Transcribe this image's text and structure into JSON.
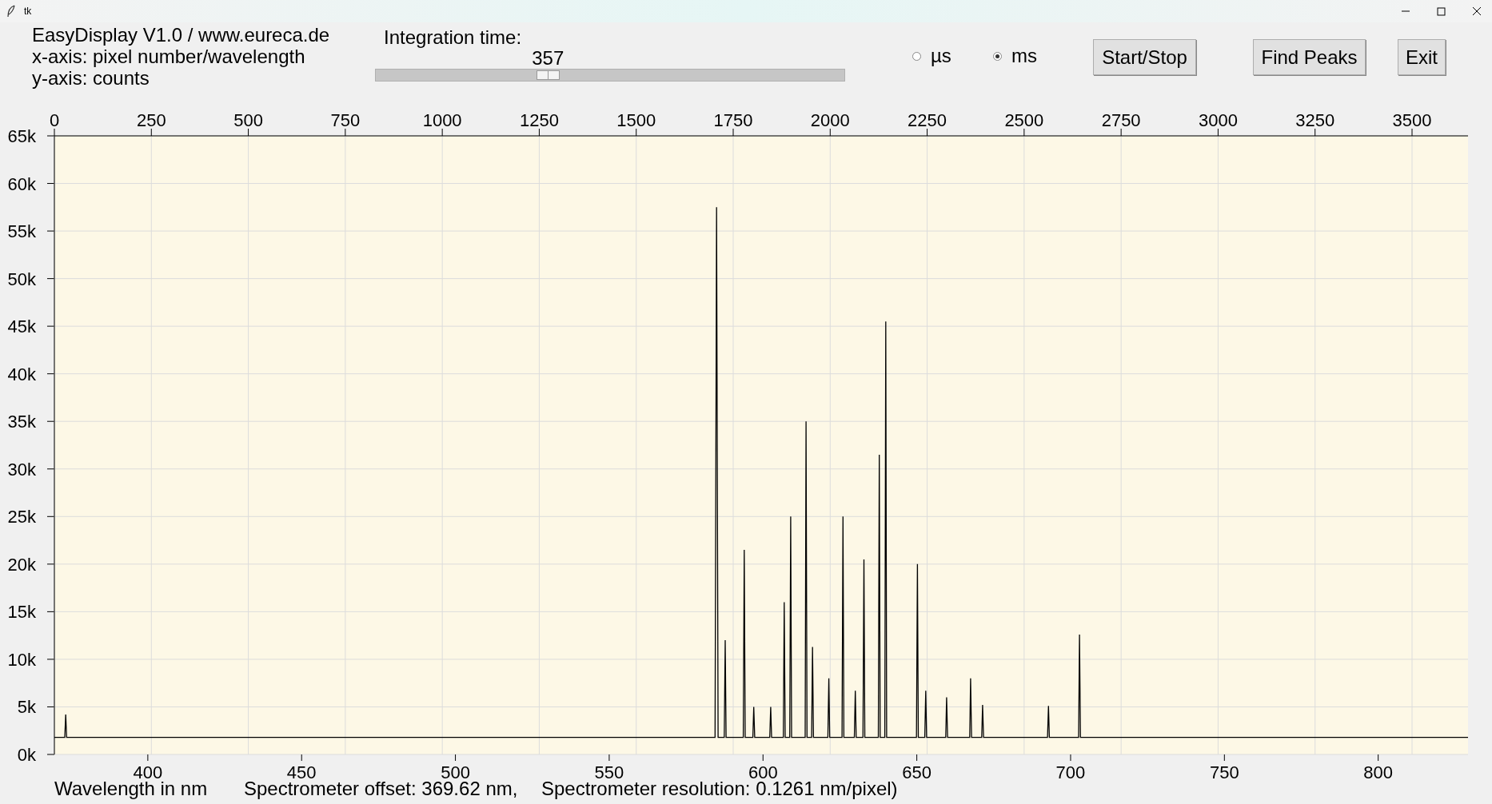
{
  "window": {
    "title": "tk"
  },
  "header": {
    "lines": [
      "EasyDisplay V1.0 / www.eureca.de",
      "x-axis: pixel number/wavelength",
      "y-axis: counts"
    ]
  },
  "integration": {
    "label": "Integration time:",
    "value": "357",
    "level": 0.36
  },
  "units": [
    {
      "label": "µs",
      "selected": false
    },
    {
      "label": "ms",
      "selected": true
    }
  ],
  "buttons": [
    "Start/Stop",
    "Find Peaks",
    "Exit"
  ],
  "pixel_axis": {
    "ticks": [
      "0",
      "250",
      "500",
      "750",
      "1000",
      "1250",
      "1500",
      "1750",
      "2000",
      "2250",
      "2500",
      "2750",
      "3000",
      "3250",
      "3500"
    ]
  },
  "chart_data": {
    "type": "line",
    "grid": true,
    "xlim": [
      369.62,
      829.2
    ],
    "ylim": [
      0,
      65000
    ],
    "xticks": [
      400,
      450,
      500,
      550,
      600,
      650,
      700,
      750,
      800
    ],
    "yticks": [
      {
        "value": 0,
        "label": "0k"
      },
      {
        "value": 5000,
        "label": "5k"
      },
      {
        "value": 10000,
        "label": "10k"
      },
      {
        "value": 15000,
        "label": "15k"
      },
      {
        "value": 20000,
        "label": "20k"
      },
      {
        "value": 25000,
        "label": "25k"
      },
      {
        "value": 30000,
        "label": "30k"
      },
      {
        "value": 35000,
        "label": "35k"
      },
      {
        "value": 40000,
        "label": "40k"
      },
      {
        "value": 45000,
        "label": "45k"
      },
      {
        "value": 50000,
        "label": "50k"
      },
      {
        "value": 55000,
        "label": "55k"
      },
      {
        "value": 60000,
        "label": "60k"
      },
      {
        "value": 65000,
        "label": "65k"
      }
    ],
    "x": [
      369.62,
      373.0,
      373.3,
      373.6,
      584.4,
      584.9,
      585.4,
      587.4,
      587.7,
      588.0,
      593.6,
      593.9,
      594.2,
      596.7,
      597.0,
      597.3,
      602.2,
      602.5,
      602.8,
      606.6,
      606.9,
      607.2,
      608.7,
      609.0,
      609.3,
      613.7,
      614.0,
      614.3,
      615.8,
      616.1,
      616.4,
      621.1,
      621.4,
      621.7,
      625.7,
      626.0,
      626.3,
      629.7,
      630.0,
      630.3,
      632.5,
      632.8,
      633.1,
      637.5,
      637.8,
      638.1,
      639.6,
      639.9,
      640.2,
      649.9,
      650.2,
      650.5,
      652.6,
      652.9,
      653.2,
      659.4,
      659.7,
      660.0,
      667.2,
      667.5,
      667.8,
      671.1,
      671.4,
      671.7,
      692.5,
      692.8,
      693.1,
      702.6,
      702.9,
      703.2,
      829.2
    ],
    "series": [
      {
        "color": "#000000",
        "values": [
          1800,
          1800,
          4200,
          1800,
          1800,
          57500,
          1800,
          1800,
          12000,
          1800,
          1800,
          21500,
          1800,
          1800,
          5000,
          1800,
          1800,
          5000,
          1800,
          1800,
          16000,
          1800,
          1800,
          25000,
          1800,
          1800,
          35000,
          1800,
          1800,
          11300,
          1800,
          1800,
          8000,
          1800,
          1800,
          25000,
          1800,
          1800,
          6700,
          1800,
          1800,
          20500,
          1800,
          1800,
          31500,
          1800,
          1800,
          45500,
          1800,
          1800,
          20000,
          1800,
          1800,
          6700,
          1800,
          1800,
          6000,
          1800,
          1800,
          8000,
          1800,
          1800,
          5200,
          1800,
          1800,
          5100,
          1800,
          1800,
          12600,
          1800,
          1800
        ]
      }
    ]
  },
  "footer": [
    "Wavelength in nm",
    "Spectrometer offset: 369.62 nm,",
    "Spectrometer resolution: 0.1261 nm/pixel)"
  ]
}
